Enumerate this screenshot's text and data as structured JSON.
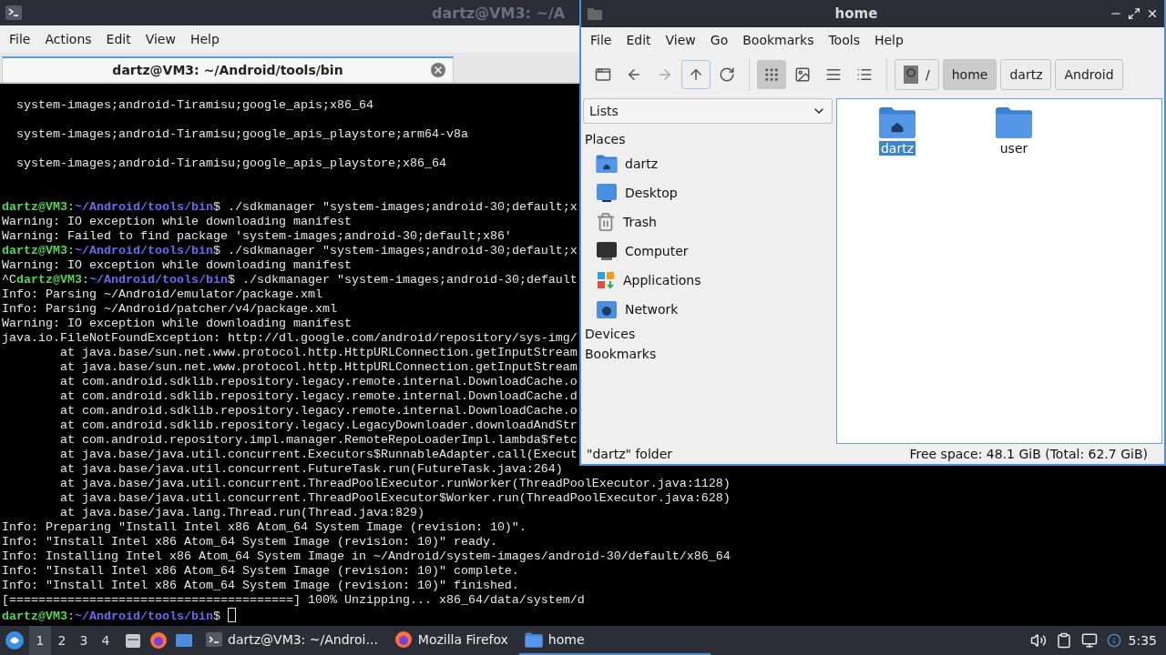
{
  "terminal": {
    "title": "dartz@VM3: ~/A",
    "menu": [
      "File",
      "Actions",
      "Edit",
      "View",
      "Help"
    ],
    "tabs": [
      {
        "label": "dartz@VM3: ~/Android/tools/bin",
        "selected": true
      }
    ],
    "lines": [
      {
        "kind": "output",
        "text": "  system-images;android-Tiramisu;google_apis;x86_64"
      },
      {
        "kind": "blank"
      },
      {
        "kind": "output",
        "text": "  system-images;android-Tiramisu;google_apis_playstore;arm64-v8a"
      },
      {
        "kind": "blank"
      },
      {
        "kind": "output",
        "text": "  system-images;android-Tiramisu;google_apis_playstore;x86_64"
      },
      {
        "kind": "blank"
      },
      {
        "kind": "blank"
      },
      {
        "kind": "prompt",
        "segments": [
          {
            "text": "dartz@VM3:",
            "color": "#55d455"
          },
          {
            "text": "~/Android/tools/bin",
            "color": "#6b6bf0"
          },
          {
            "text": "$ ./sdkmanager \"system-images;android-30;default;x",
            "color": "#e6e6e6"
          }
        ]
      },
      {
        "kind": "output",
        "text": "Warning: IO exception while downloading manifest"
      },
      {
        "kind": "output",
        "text": "Warning: Failed to find package 'system-images;android-30;default;x86'"
      },
      {
        "kind": "prompt",
        "segments": [
          {
            "text": "dartz@VM3:",
            "color": "#55d455"
          },
          {
            "text": "~/Android/tools/bin",
            "color": "#6b6bf0"
          },
          {
            "text": "$ ./sdkmanager \"system-images;android-30;default;x",
            "color": "#e6e6e6"
          }
        ]
      },
      {
        "kind": "output",
        "text": "Warning: IO exception while downloading manifest"
      },
      {
        "kind": "prompt",
        "segments": [
          {
            "text": "^C",
            "color": "#e6e6e6"
          },
          {
            "text": "dartz@VM3:",
            "color": "#55d455"
          },
          {
            "text": "~/Android/tools/bin",
            "color": "#6b6bf0"
          },
          {
            "text": "$ ./sdkmanager \"system-images;android-30;default",
            "color": "#e6e6e6"
          }
        ]
      },
      {
        "kind": "output",
        "text": "Info: Parsing ~/Android/emulator/package.xml"
      },
      {
        "kind": "output",
        "text": "Info: Parsing ~/Android/patcher/v4/package.xml"
      },
      {
        "kind": "output",
        "text": "Warning: IO exception while downloading manifest"
      },
      {
        "kind": "output",
        "text": "java.io.FileNotFoundException: http://dl.google.com/android/repository/sys-img/"
      },
      {
        "kind": "output",
        "text": "        at java.base/sun.net.www.protocol.http.HttpURLConnection.getInputStream"
      },
      {
        "kind": "output",
        "text": "        at java.base/sun.net.www.protocol.http.HttpURLConnection.getInputStream"
      },
      {
        "kind": "output",
        "text": "        at com.android.sdklib.repository.legacy.remote.internal.DownloadCache.o"
      },
      {
        "kind": "output",
        "text": "        at com.android.sdklib.repository.legacy.remote.internal.DownloadCache.d"
      },
      {
        "kind": "output",
        "text": "        at com.android.sdklib.repository.legacy.remote.internal.DownloadCache.o"
      },
      {
        "kind": "output",
        "text": "        at com.android.sdklib.repository.legacy.LegacyDownloader.downloadAndStr"
      },
      {
        "kind": "output",
        "text": "        at com.android.repository.impl.manager.RemoteRepoLoaderImpl.lambda$fetc"
      },
      {
        "kind": "output",
        "text": "        at java.base/java.util.concurrent.Executors$RunnableAdapter.call(Execut"
      },
      {
        "kind": "output",
        "text": "        at java.base/java.util.concurrent.FutureTask.run(FutureTask.java:264)"
      },
      {
        "kind": "output",
        "text": "        at java.base/java.util.concurrent.ThreadPoolExecutor.runWorker(ThreadPoolExecutor.java:1128)"
      },
      {
        "kind": "output",
        "text": "        at java.base/java.util.concurrent.ThreadPoolExecutor$Worker.run(ThreadPoolExecutor.java:628)"
      },
      {
        "kind": "output",
        "text": "        at java.base/java.lang.Thread.run(Thread.java:829)"
      },
      {
        "kind": "output",
        "text": "Info: Preparing \"Install Intel x86 Atom_64 System Image (revision: 10)\"."
      },
      {
        "kind": "output",
        "text": "Info: \"Install Intel x86 Atom_64 System Image (revision: 10)\" ready."
      },
      {
        "kind": "output",
        "text": "Info: Installing Intel x86 Atom_64 System Image in ~/Android/system-images/android-30/default/x86_64"
      },
      {
        "kind": "output",
        "text": "Info: \"Install Intel x86 Atom_64 System Image (revision: 10)\" complete."
      },
      {
        "kind": "output",
        "text": "Info: \"Install Intel x86 Atom_64 System Image (revision: 10)\" finished."
      },
      {
        "kind": "output",
        "text": "[=======================================] 100% Unzipping... x86_64/data/system/d"
      },
      {
        "kind": "prompt",
        "cursor": true,
        "segments": [
          {
            "text": "dartz@VM3:",
            "color": "#55d455"
          },
          {
            "text": "~/Android/tools/bin",
            "color": "#6b6bf0"
          },
          {
            "text": "$ ",
            "color": "#e6e6e6"
          }
        ]
      }
    ]
  },
  "file_manager": {
    "title": "home",
    "menu": [
      "File",
      "Edit",
      "View",
      "Go",
      "Bookmarks",
      "Tools",
      "Help"
    ],
    "nav": [
      {
        "kind": "new-window",
        "disabled": false,
        "hovered": false
      },
      {
        "kind": "back",
        "disabled": false,
        "hovered": false
      },
      {
        "kind": "forward",
        "disabled": true,
        "hovered": false
      },
      {
        "kind": "up",
        "disabled": false,
        "hovered": true
      },
      {
        "kind": "reload",
        "disabled": false,
        "hovered": false
      }
    ],
    "view_modes": [
      {
        "kind": "icons",
        "selected": true
      },
      {
        "kind": "thumbnails",
        "selected": false
      },
      {
        "kind": "compact",
        "selected": false
      },
      {
        "kind": "details",
        "selected": false
      }
    ],
    "path": [
      {
        "kind": "root",
        "label": "/",
        "selected": false
      },
      {
        "kind": "dir",
        "label": "home",
        "selected": true
      },
      {
        "kind": "dir",
        "label": "dartz",
        "selected": false
      },
      {
        "kind": "dir",
        "label": "Android",
        "selected": false
      }
    ],
    "side_pane": {
      "mode": "Lists",
      "sections": [
        {
          "heading": "Places",
          "items": [
            {
              "label": "dartz",
              "kind": "home"
            },
            {
              "label": "Desktop",
              "kind": "desktop"
            },
            {
              "label": "Trash",
              "kind": "trash"
            },
            {
              "label": "Computer",
              "kind": "computer"
            },
            {
              "label": "Applications",
              "kind": "applications"
            },
            {
              "label": "Network",
              "kind": "network"
            }
          ]
        },
        {
          "heading": "Devices"
        },
        {
          "heading": "Bookmarks"
        }
      ]
    },
    "files": [
      {
        "name": "dartz",
        "kind": "home-folder",
        "selected": true
      },
      {
        "name": "user",
        "kind": "folder",
        "selected": false
      }
    ],
    "status": {
      "left": "\"dartz\" folder",
      "right": "Free space: 48.1 GiB (Total: 62.7 GiB)"
    }
  },
  "taskbar": {
    "workspaces": [
      {
        "label": "1",
        "selected": true
      },
      {
        "label": "2",
        "selected": false
      },
      {
        "label": "3",
        "selected": false
      },
      {
        "label": "4",
        "selected": false
      }
    ],
    "launchers": [
      {
        "kind": "files"
      },
      {
        "kind": "firefox"
      },
      {
        "kind": "desktop"
      }
    ],
    "tasks": [
      {
        "kind": "terminal",
        "label": "dartz@VM3: ~/Androi...",
        "selected": false
      },
      {
        "kind": "firefox",
        "label": "Mozilla Firefox",
        "selected": false
      },
      {
        "kind": "folder",
        "label": "home",
        "selected": true
      }
    ],
    "clock": "5:35"
  }
}
